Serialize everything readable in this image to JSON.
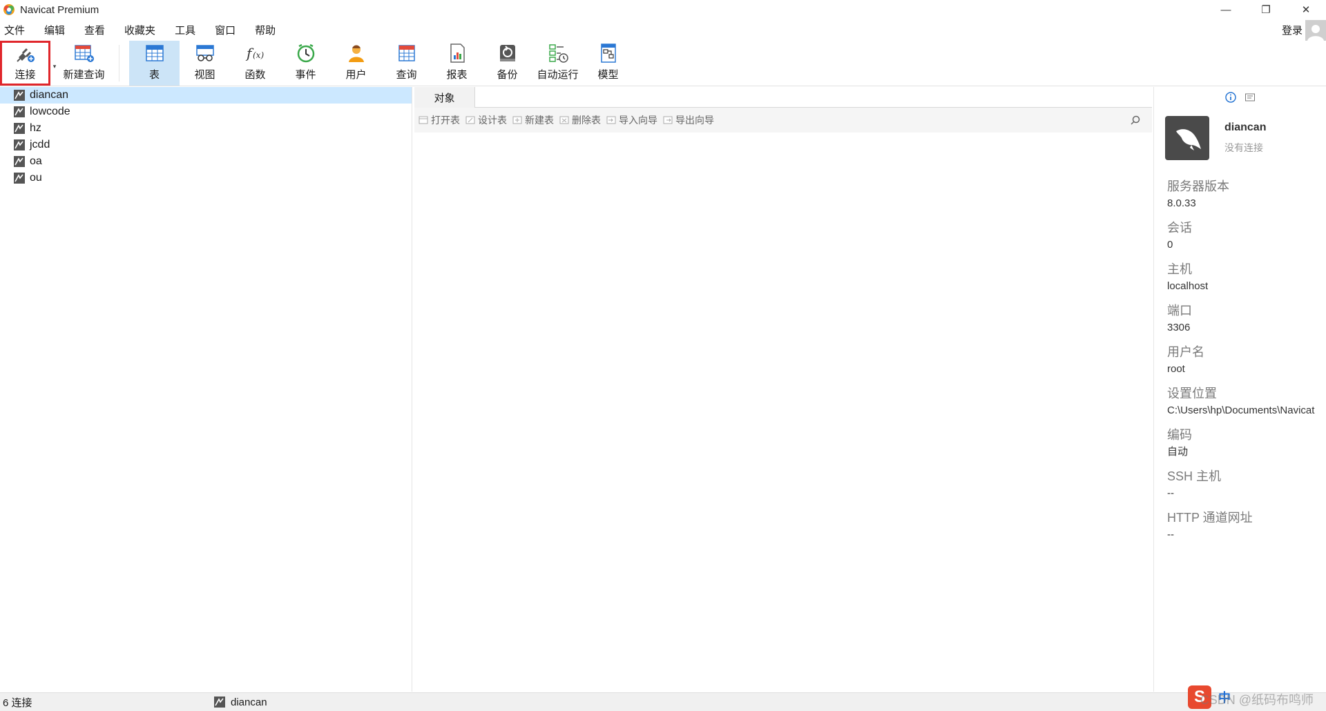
{
  "window": {
    "title": "Navicat Premium",
    "controls": {
      "minimize": "—",
      "restore": "❐",
      "close": "✕"
    }
  },
  "menubar": {
    "items": [
      "文件",
      "编辑",
      "查看",
      "收藏夹",
      "工具",
      "窗口",
      "帮助"
    ],
    "login": "登录"
  },
  "toolbar": {
    "connect": "连接",
    "new_query": "新建查询",
    "table": "表",
    "view": "视图",
    "function": "函数",
    "event": "事件",
    "user": "用户",
    "query": "查询",
    "report": "报表",
    "backup": "备份",
    "automation": "自动运行",
    "model": "模型"
  },
  "navigator": {
    "connections": [
      "diancan",
      "lowcode",
      "hz",
      "jcdd",
      "oa",
      "ou"
    ],
    "selected": "diancan"
  },
  "objects": {
    "tab": "对象",
    "actions": {
      "open": "打开表",
      "design": "设计表",
      "new": "新建表",
      "delete": "删除表",
      "import": "导入向导",
      "export": "导出向导"
    }
  },
  "info": {
    "name": "diancan",
    "status": "没有连接",
    "fields": [
      {
        "label": "服务器版本",
        "value": "8.0.33"
      },
      {
        "label": "会话",
        "value": "0"
      },
      {
        "label": "主机",
        "value": "localhost"
      },
      {
        "label": "端口",
        "value": "3306"
      },
      {
        "label": "用户名",
        "value": "root"
      },
      {
        "label": "设置位置",
        "value": "C:\\Users\\hp\\Documents\\Navicat"
      },
      {
        "label": "编码",
        "value": "自动"
      },
      {
        "label": "SSH 主机",
        "value": "--"
      },
      {
        "label": "HTTP 通道网址",
        "value": "--"
      }
    ]
  },
  "statusbar": {
    "count": "6 连接",
    "current": "diancan"
  },
  "ime": {
    "logo": "S",
    "mode": "中"
  },
  "watermark": "CSDN @纸码布鸣师",
  "colors": {
    "accent": "#cce4f7",
    "selected_row": "#cce8ff",
    "highlight_box": "#e0262b"
  }
}
